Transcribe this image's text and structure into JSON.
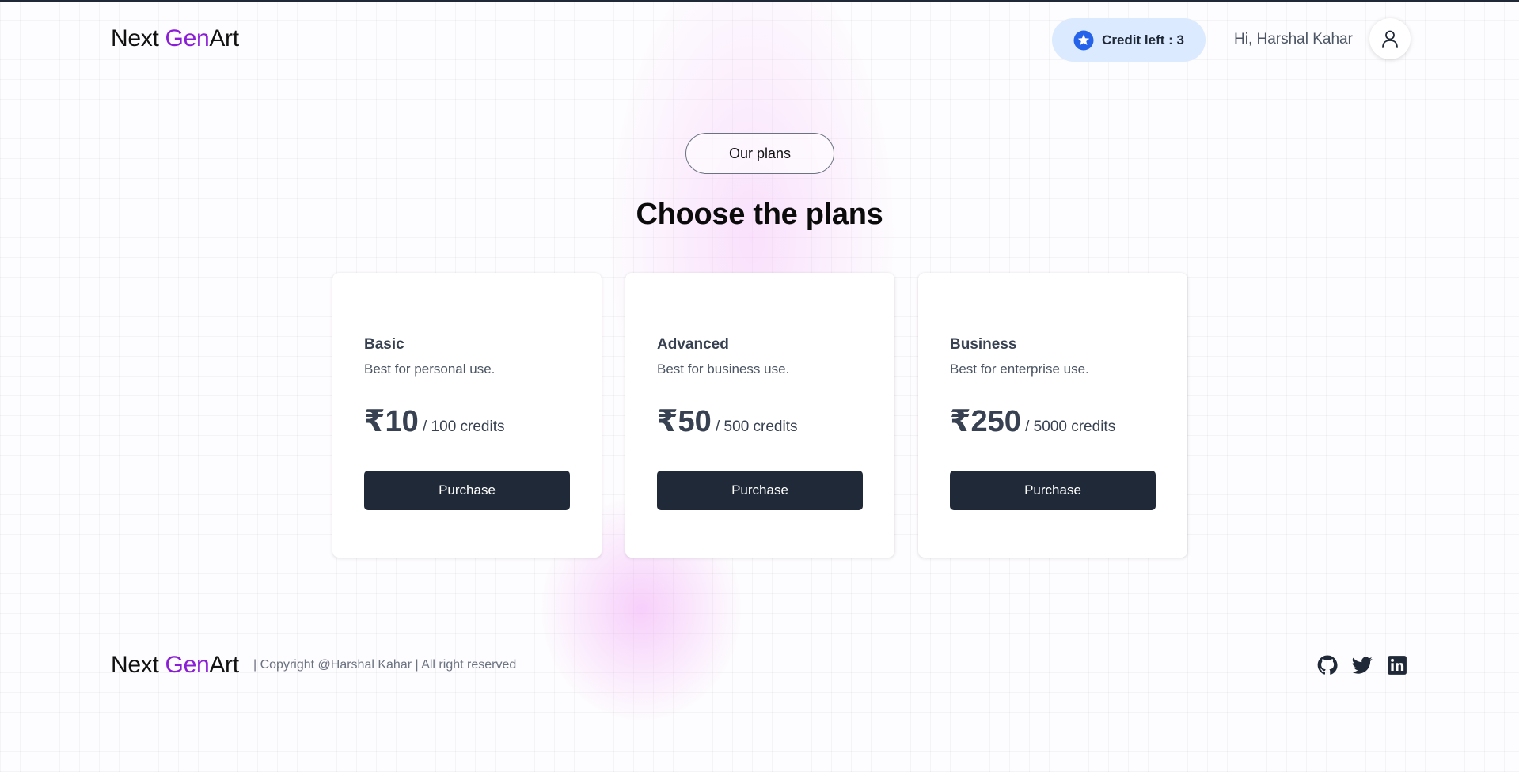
{
  "header": {
    "logo_prefix": "Next ",
    "logo_highlight": "Gen",
    "logo_suffix": "Art",
    "credit_label": "Credit left : 3",
    "greeting": "Hi, Harshal Kahar",
    "star_icon": "star-icon",
    "avatar_icon": "user-icon"
  },
  "section": {
    "tag": "Our plans",
    "title": "Choose the plans"
  },
  "plans": [
    {
      "name": "Basic",
      "description": "Best for personal use.",
      "price": "₹10",
      "unit": " / 100 credits",
      "button": "Purchase"
    },
    {
      "name": "Advanced",
      "description": "Best for business use.",
      "price": "₹50",
      "unit": " / 500 credits",
      "button": "Purchase"
    },
    {
      "name": "Business",
      "description": "Best for enterprise use.",
      "price": "₹250",
      "unit": " / 5000 credits",
      "button": "Purchase"
    }
  ],
  "footer": {
    "logo_prefix": "Next ",
    "logo_highlight": "Gen",
    "logo_suffix": "Art",
    "copyright": "| Copyright @Harshal Kahar | All right reserved",
    "social_icons": [
      "github-icon",
      "twitter-icon",
      "linkedin-icon"
    ]
  },
  "colors": {
    "brand_accent": "#8a1ed6",
    "credit_pill_bg": "#dbeafe",
    "star_blue": "#2563eb",
    "button_bg": "#1f2937"
  }
}
